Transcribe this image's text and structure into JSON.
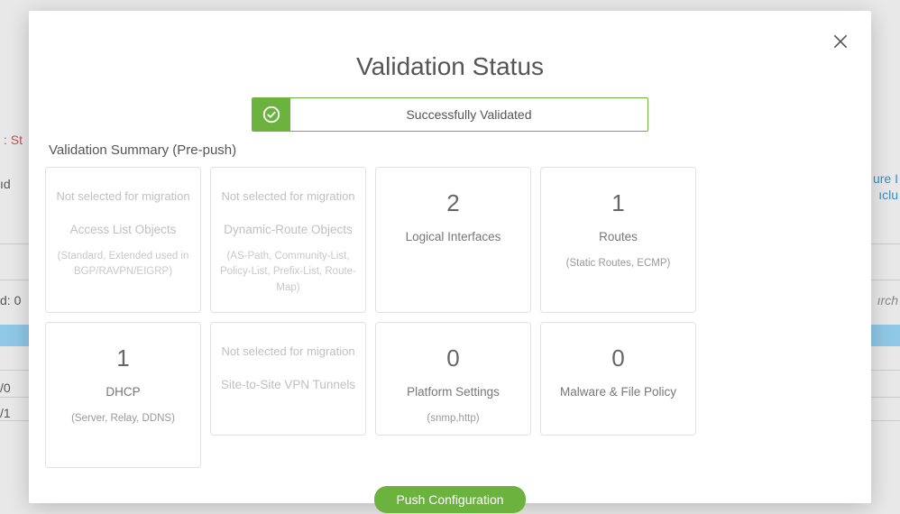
{
  "modal": {
    "title": "Validation Status",
    "status_text": "Successfully Validated",
    "summary_label": "Validation Summary (Pre-push)",
    "push_button": "Push Configuration"
  },
  "cards": [
    {
      "not_selected": "Not selected for migration",
      "title": "Access List Objects",
      "sub": "(Standard, Extended used in BGP/RAVPN/EIGRP)"
    },
    {
      "not_selected": "Not selected for migration",
      "title": "Dynamic-Route Objects",
      "sub": "(AS-Path, Community-List, Policy-List, Prefix-List, Route-Map)"
    },
    {
      "count": "2",
      "title": "Logical Interfaces",
      "sub": ""
    },
    {
      "count": "1",
      "title": "Routes",
      "sub": "(Static Routes, ECMP)"
    },
    {
      "count": "1",
      "title": "DHCP",
      "sub": "(Server, Relay, DDNS)"
    },
    {
      "not_selected": "Not selected for migration",
      "title": "Site-to-Site VPN Tunnels",
      "sub": ""
    },
    {
      "count": "0",
      "title": "Platform Settings",
      "sub": "(snmp,http)"
    },
    {
      "count": "0",
      "title": "Malware & File Policy",
      "sub": ""
    }
  ],
  "bg": {
    "st": ": St",
    "id": "ıd",
    "d0": "d: 0",
    "r0": "/0",
    "r1": "/1",
    "ure": "ure I",
    "clu": "ıclu",
    "irch": "ırch"
  }
}
